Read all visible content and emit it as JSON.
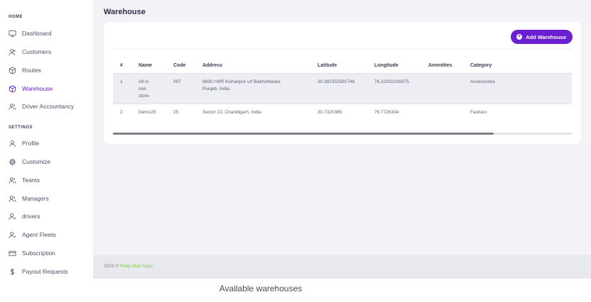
{
  "sidebar": {
    "home_title": "HOME",
    "settings_title": "SETTINGS",
    "home_items": [
      {
        "label": "Dashboard",
        "icon": "monitor-icon"
      },
      {
        "label": "Customers",
        "icon": "user-plus-icon"
      },
      {
        "label": "Routes",
        "icon": "box-icon"
      },
      {
        "label": "Warehouse",
        "icon": "box-icon",
        "active": true
      },
      {
        "label": "Driver Accountancy",
        "icon": "users-icon"
      }
    ],
    "settings_items": [
      {
        "label": "Profile",
        "icon": "user-icon"
      },
      {
        "label": "Customize",
        "icon": "gear-icon"
      },
      {
        "label": "Teams",
        "icon": "users-icon"
      },
      {
        "label": "Managers",
        "icon": "users-icon"
      },
      {
        "label": "drivers",
        "icon": "user-check-icon"
      },
      {
        "label": "Agent Fleets",
        "icon": "user-check-icon"
      },
      {
        "label": "Subscription",
        "icon": "credit-card-icon"
      },
      {
        "label": "Payout Requests",
        "icon": "dollar-icon"
      }
    ]
  },
  "main": {
    "title": "Warehouse",
    "add_button_label": "Add Warehouse",
    "add_button_icon": "plus-circle-icon",
    "table": {
      "headers": [
        "#",
        "Name",
        "Code",
        "Address",
        "Latitude",
        "Longitude",
        "Amenities",
        "Category"
      ],
      "rows": [
        [
          "1",
          "All in one store",
          "007",
          "983C+WR Kishanpur urf Bakhshiwala, Punjab, India",
          "30.382352581746",
          "76.32202109375",
          "",
          "Accessories"
        ],
        [
          "2",
          "Demo25",
          "25",
          "Sector 22, Chandigarh, India",
          "30.7320385",
          "76.7726334",
          "",
          "Fashion"
        ]
      ]
    },
    "scroll_fraction": 0.83
  },
  "footer": {
    "prefix": "2023 © ",
    "link": "Rudy Mart Apps"
  },
  "caption": "Available warehouses",
  "colors": {
    "accent": "#6a1fd1",
    "footer_link": "#7bd13a"
  }
}
